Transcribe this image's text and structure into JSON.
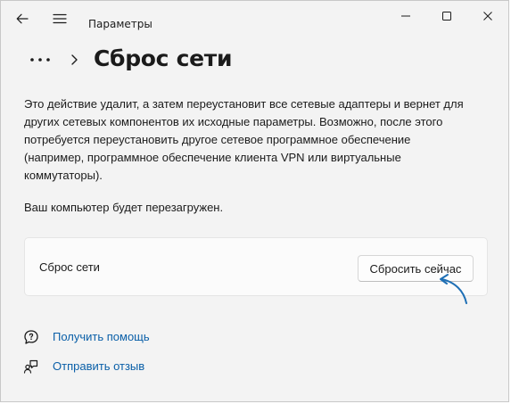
{
  "titlebar": {
    "title": "Параметры",
    "back_icon": "arrow-left-icon",
    "menu_icon": "hamburger-icon",
    "controls": [
      "minimize-icon",
      "maximize-icon",
      "close-icon"
    ]
  },
  "header": {
    "more_icon": "ellipsis-icon",
    "chevron_icon": "chevron-right-icon",
    "title": "Сброс сети"
  },
  "description": [
    "Это действие удалит, а затем переустановит все сетевые адаптеры и вернет для",
    "других сетевых компонентов их исходные параметры. Возможно, после этого",
    "потребуется переустановить другое сетевое программное обеспечение",
    "(например, программное обеспечение клиента VPN или виртуальные",
    "коммутаторы)."
  ],
  "restart_note": "Ваш компьютер будет перезагружен.",
  "card": {
    "label": "Сброс сети",
    "button_label": "Сбросить сейчас"
  },
  "links": [
    {
      "label": "Получить помощь",
      "icon": "help-chat-icon"
    },
    {
      "label": "Отправить отзыв",
      "icon": "feedback-icon"
    }
  ],
  "colors": {
    "link": "#0a5fa8",
    "arrow": "#1e6fb5",
    "window_bg": "#f3f3f3",
    "card_bg": "#fbfbfb"
  }
}
